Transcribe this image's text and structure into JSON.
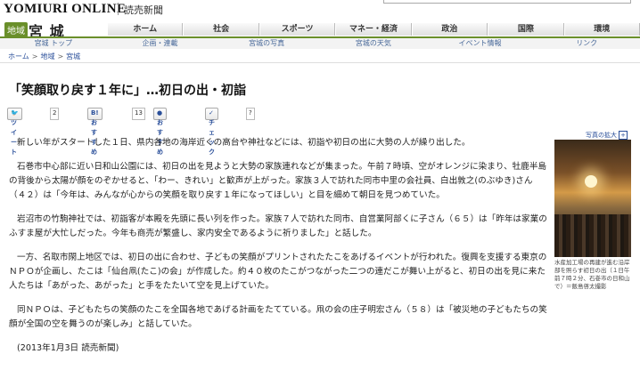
{
  "site": {
    "logo": "YOMIURI ONLINE",
    "sub": "読売新聞"
  },
  "region": {
    "badge": "地域",
    "name": "宮 城"
  },
  "nav_main": [
    "ホーム",
    "社会",
    "スポーツ",
    "マネー・経済",
    "政治",
    "国際",
    "環境"
  ],
  "nav_sub": [
    "宮城 トップ",
    "企画・連載",
    "宮城の写真",
    "宮城の天気",
    "イベント情報",
    "リンク"
  ],
  "breadcrumb": [
    "ホーム",
    "地域",
    "宮城"
  ],
  "article": {
    "title": "「笑顔取り戻す１年に」…初日の出・初詣",
    "paragraphs": [
      "新しい年がスタートした１日、県内各地の海岸近くの高台や神社などには、初詣や初日の出に大勢の人が繰り出した。",
      "石巻市中心部に近い日和山公園には、初日の出を見ようと大勢の家族連れなどが集まった。午前７時頃、空がオレンジに染まり、牡鹿半島の背後から太陽が顔をのぞかせると、「わー、きれい」と歓声が上がった。家族３人で訪れた同市中里の会社員、白出敦之(のぶゆき)さん（４２）は「今年は、みんなが心からの笑顔を取り戻す１年になってほしい」と目を細めて朝日を見つめていた。",
      "岩沼市の竹駒神社では、初詣客が本殿を先頭に長い列を作った。家族７人で訪れた同市、自営業阿部くに子さん（６５）は「昨年は家業のふすま屋が大忙しだった。今年も商売が繁盛し、家内安全であるように祈りました」と話した。",
      "一方、名取市閖上地区では、初日の出に合わせ、子どもの笑顔がプリントされたたこをあげるイベントが行われた。復興を支援する東京のＮＰＯが企画し、たこは「仙台凧(たこ)の会」が作成した。約４０枚のたこがつながった二つの連だこが舞い上がると、初日の出を見に来た人たちは「あがった、あがった」と手をたたいて空を見上げていた。",
      "同ＮＰＯは、子どもたちの笑顔のたこを全国各地であげる計画をたてている。凧の会の庄子明宏さん（５８）は「被災地の子どもたちの笑顔が全国の空を舞うのが楽しみ」と話していた。"
    ],
    "date": "(2013年1月3日  読売新聞)"
  },
  "share": {
    "tweet_label": "ツイート",
    "tweet_count": "2",
    "hatena_label": "おすすめ",
    "hatena_count": "13",
    "like_label": "おすすめ",
    "check_label": "チェック",
    "help": "?"
  },
  "photo": {
    "enlarge": "写真の拡大",
    "caption": "水産加工場の再建が進む沿岸部を照らす初日の出（１日午前７時２分、石巻市の日和山で）＝飯島啓太撮影"
  },
  "colors": {
    "accent_green": "#6a8f2a",
    "link_blue": "#2a4f9a"
  }
}
